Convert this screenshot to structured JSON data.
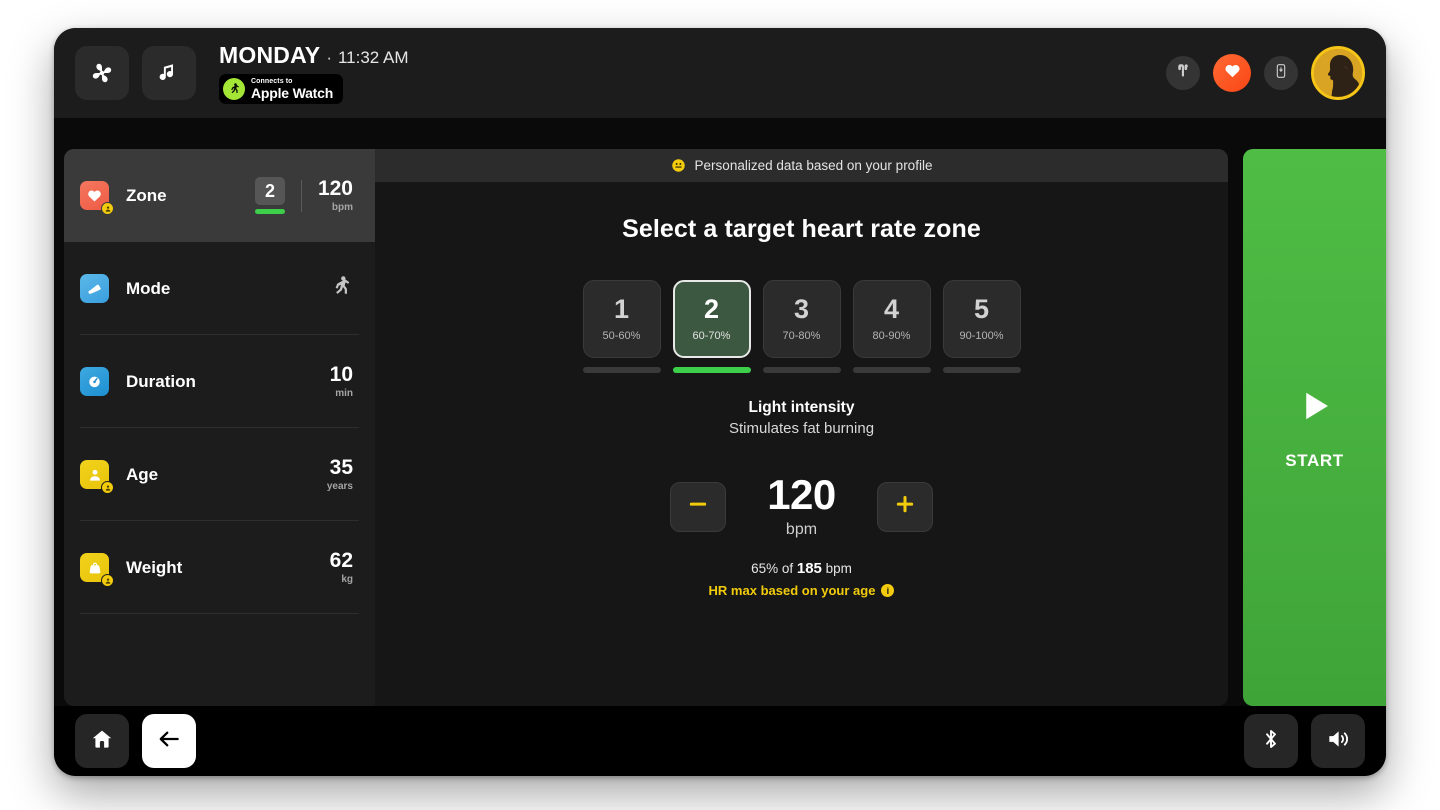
{
  "topbar": {
    "fan_icon": "fan-icon",
    "music_icon": "music-note-icon",
    "day": "MONDAY",
    "separator": "·",
    "time": "11:32 AM",
    "watch_badge": {
      "small": "Connects to",
      "name": "Apple Watch",
      "icon": "running-person-icon"
    },
    "right_icons": [
      {
        "name": "earbuds-icon",
        "label": "earbuds"
      },
      {
        "name": "heart-icon",
        "label": "heart rate",
        "color": "#fa4616"
      },
      {
        "name": "phone-icon",
        "label": "phone"
      }
    ],
    "avatar": {
      "name": "user-avatar",
      "ring_color": "#f5c518"
    }
  },
  "sidebar": {
    "items": [
      {
        "label": "Zone",
        "icon": "heart-icon",
        "personalized": true,
        "zone_number": "2",
        "value": "120",
        "unit": "bpm",
        "active": true
      },
      {
        "label": "Mode",
        "icon": "shoe-icon",
        "personalized": false,
        "value": "",
        "unit": "",
        "mode_icon": "running-person-icon",
        "active": false
      },
      {
        "label": "Duration",
        "icon": "timer-icon",
        "personalized": false,
        "value": "10",
        "unit": "min",
        "active": false
      },
      {
        "label": "Age",
        "icon": "person-icon",
        "personalized": true,
        "value": "35",
        "unit": "years",
        "active": false
      },
      {
        "label": "Weight",
        "icon": "weight-icon",
        "personalized": true,
        "value": "62",
        "unit": "kg",
        "active": false
      }
    ]
  },
  "main": {
    "profile_strip": {
      "icon": "smiley-face-icon",
      "text": "Personalized data based on your profile"
    },
    "title": "Select a target heart rate zone",
    "zones": [
      {
        "number": "1",
        "percent": "50-60%",
        "selected": false
      },
      {
        "number": "2",
        "percent": "60-70%",
        "selected": true
      },
      {
        "number": "3",
        "percent": "70-80%",
        "selected": false
      },
      {
        "number": "4",
        "percent": "80-90%",
        "selected": false
      },
      {
        "number": "5",
        "percent": "90-100%",
        "selected": false
      }
    ],
    "intensity": {
      "title": "Light intensity",
      "subtitle": "Stimulates fat burning"
    },
    "stepper": {
      "decrease_label": "−",
      "increase_label": "+",
      "value": "120",
      "unit": "bpm"
    },
    "hr_max": {
      "prefix": "65% of ",
      "value": "185",
      "suffix": " bpm",
      "note": "HR max based on your age",
      "info_glyph": "i"
    }
  },
  "start_panel": {
    "label": "START",
    "play_icon": "play-icon",
    "color": "#4fbd45"
  },
  "bottombar": {
    "left": [
      {
        "name": "home-icon",
        "style": "dark"
      },
      {
        "name": "back-arrow-icon",
        "style": "light"
      }
    ],
    "right": [
      {
        "name": "bluetooth-icon"
      },
      {
        "name": "volume-icon"
      }
    ]
  }
}
